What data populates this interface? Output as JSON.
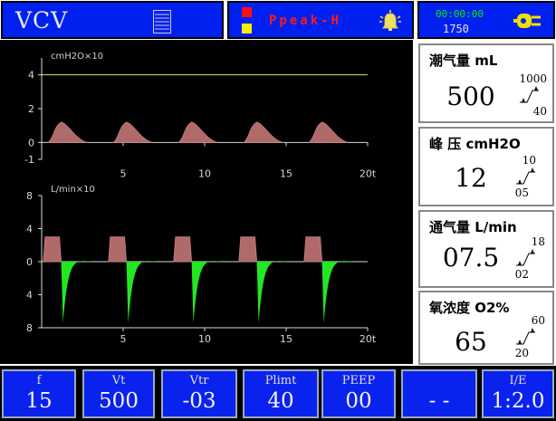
{
  "header": {
    "mode": "VCV",
    "alarm_text": "Ppeak-H",
    "alarm_colors": {
      "high": "#ff1010",
      "medium": "#ffee00"
    },
    "time": "00:00:00",
    "count": "1750",
    "icons": [
      "menu-lines-icon",
      "alarm-bell-icon",
      "power-plug-icon"
    ]
  },
  "chart_data": [
    {
      "type": "line",
      "ylabel": "cmH2O×10",
      "y_ticks": [
        "4",
        "2",
        "0",
        "-1"
      ],
      "x_ticks": [
        "5",
        "10",
        "15",
        "20t"
      ],
      "ylim": [
        -1,
        5
      ],
      "xlim": [
        0,
        20
      ],
      "limit_line": 4,
      "limit_color": "#e8e060",
      "fill_color": "#b06a6a",
      "breaths": [
        {
          "start": 0.4,
          "peak": 1.2,
          "peak_value": 1.2,
          "end": 2.8
        },
        {
          "start": 4.4,
          "peak": 5.2,
          "peak_value": 1.2,
          "end": 6.8
        },
        {
          "start": 8.4,
          "peak": 9.2,
          "peak_value": 1.2,
          "end": 10.8
        },
        {
          "start": 12.4,
          "peak": 13.2,
          "peak_value": 1.2,
          "end": 14.8
        },
        {
          "start": 16.4,
          "peak": 17.2,
          "peak_value": 1.2,
          "end": 18.8
        }
      ]
    },
    {
      "type": "area",
      "ylabel": "L/min×10",
      "y_ticks": [
        "8",
        "4",
        "0",
        "4",
        "8"
      ],
      "x_ticks": [
        "5",
        "10",
        "15",
        "20t"
      ],
      "ylim": [
        -8,
        8
      ],
      "xlim": [
        0,
        20
      ],
      "insp_color": "#b06a6a",
      "exp_color": "#22e822",
      "breaths": [
        {
          "start": 0.1,
          "insp_end": 1.2,
          "insp_flow": 3.0,
          "exp_end": 3.1,
          "exp_peak": -7.5
        },
        {
          "start": 4.1,
          "insp_end": 5.2,
          "insp_flow": 3.0,
          "exp_end": 7.1,
          "exp_peak": -7.5
        },
        {
          "start": 8.1,
          "insp_end": 9.2,
          "insp_flow": 3.0,
          "exp_end": 11.1,
          "exp_peak": -7.5
        },
        {
          "start": 12.1,
          "insp_end": 13.2,
          "insp_flow": 3.0,
          "exp_end": 15.1,
          "exp_peak": -7.5
        },
        {
          "start": 16.1,
          "insp_end": 17.2,
          "insp_flow": 3.0,
          "exp_end": 19.1,
          "exp_peak": -7.5
        }
      ]
    }
  ],
  "panels": [
    {
      "title": "潮气量 mL",
      "value": "500",
      "high": "1000",
      "low": "40"
    },
    {
      "title": "峰  压 cmH2O",
      "value": "12",
      "high": "10",
      "low": "05"
    },
    {
      "title": "通气量 L/min",
      "value": "07.5",
      "high": "18",
      "low": "02"
    },
    {
      "title": "氧浓度 O2%",
      "value": "65",
      "high": "60",
      "low": "20"
    }
  ],
  "buttons": [
    {
      "label": "f",
      "value": "15"
    },
    {
      "label": "Vt",
      "value": "500"
    },
    {
      "label": "Vtr",
      "value": "-03"
    },
    {
      "label": "Plimt",
      "value": "40"
    },
    {
      "label": "PEEP",
      "value": "00"
    },
    {
      "label": "",
      "value": "- -"
    },
    {
      "label": "I/E",
      "value": "1:2.0"
    }
  ]
}
